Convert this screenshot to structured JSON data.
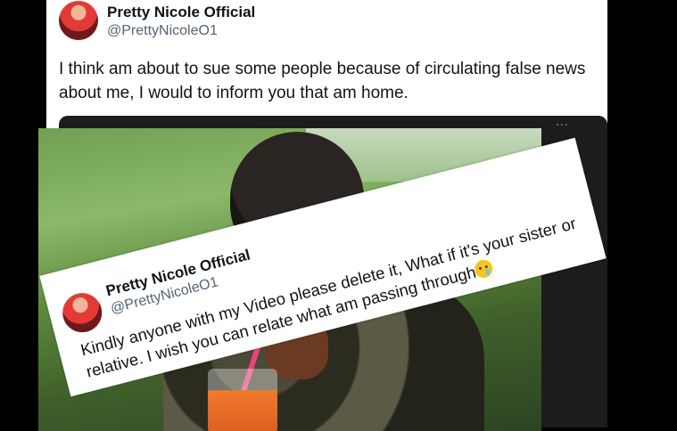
{
  "post": {
    "author_name": "Pretty Nicole Official",
    "author_handle": "@PrettyNicoleO1",
    "text": "I think am about to sue some people because of circulating false news about me, I would to inform you that am home."
  },
  "overlay_post": {
    "author_name": "Pretty Nicole Official",
    "author_handle": "@PrettyNicoleO1",
    "text": "Kindly anyone with my Video please delete it, What if it's your sister or relative. I wish you can relate what am passing through",
    "emoji": "crying-face-emoji",
    "more_label": "..."
  },
  "icons": [
    "avatar",
    "more-icon",
    "crying-face-emoji"
  ]
}
